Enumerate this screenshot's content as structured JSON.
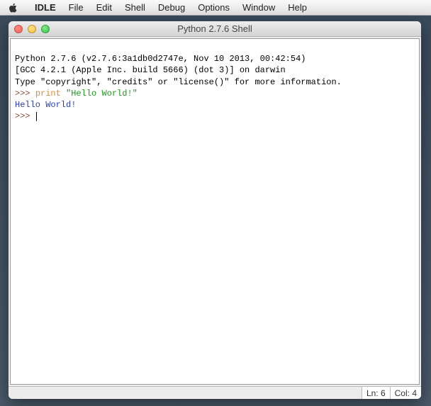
{
  "menubar": {
    "items": [
      "IDLE",
      "File",
      "Edit",
      "Shell",
      "Debug",
      "Options",
      "Window",
      "Help"
    ]
  },
  "window": {
    "title": "Python 2.7.6 Shell"
  },
  "shell": {
    "line1": "Python 2.7.6 (v2.7.6:3a1db0d2747e, Nov 10 2013, 00:42:54)",
    "line2": "[GCC 4.2.1 (Apple Inc. build 5666) (dot 3)] on darwin",
    "line3": "Type \"copyright\", \"credits\" or \"license()\" for more information.",
    "prompt1": ">>> ",
    "keyword_print": "print",
    "space": " ",
    "string_hello": "\"Hello World!\"",
    "output": "Hello World!",
    "prompt2": ">>> "
  },
  "status": {
    "line_label": "Ln: 6",
    "col_label": "Col: 4"
  }
}
